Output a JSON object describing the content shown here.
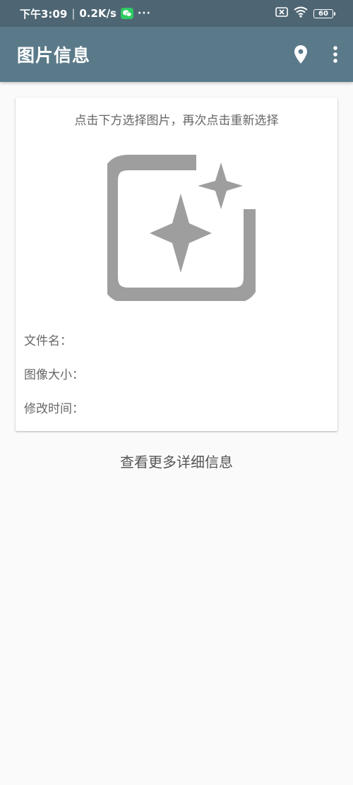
{
  "status_bar": {
    "time": "下午3:09",
    "separator": "|",
    "net_speed": "0.2K/s",
    "more": "···",
    "battery": "60",
    "icons": [
      "wechat-icon",
      "sim-off-icon",
      "wifi-icon",
      "battery-icon"
    ]
  },
  "app_bar": {
    "title": "图片信息",
    "actions": [
      "location-pin-icon",
      "more-vert-icon"
    ]
  },
  "card": {
    "hint": "点击下方选择图片，再次点击重新选择",
    "image_picker_icon": "add-photo-sparkle-icon",
    "file_name_label": "文件名：",
    "image_size_label": "图像大小：",
    "modified_time_label": "修改时间："
  },
  "more_info_label": "查看更多详细信息",
  "colors": {
    "status_bar": "#4e6674",
    "app_bar": "#5b7a89",
    "background": "#fafafa",
    "icon_gray": "#9e9e9e",
    "text_gray": "#666666"
  }
}
